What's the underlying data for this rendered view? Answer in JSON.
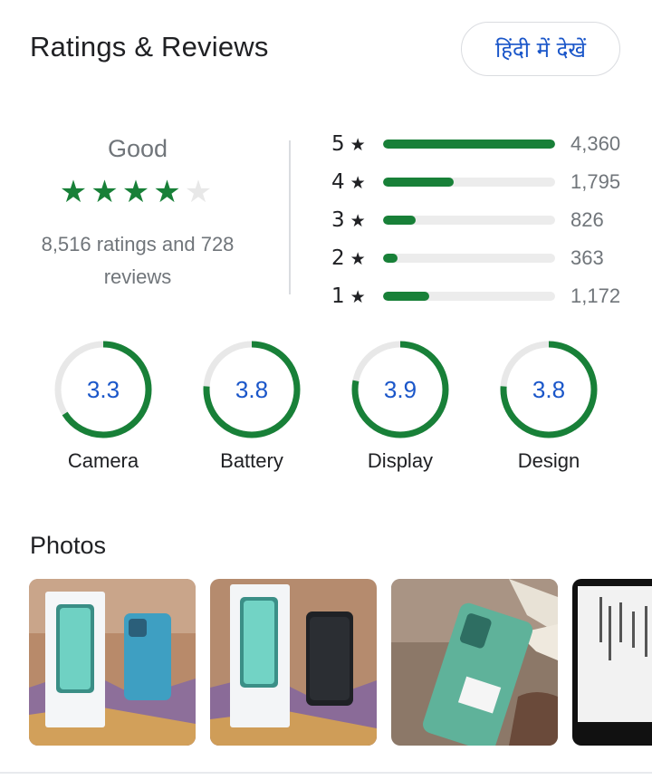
{
  "header": {
    "title": "Ratings & Reviews",
    "language_button": "हिंदी में देखें"
  },
  "summary": {
    "verdict": "Good",
    "stars_filled": 4,
    "stars_total": 5,
    "count_text": "8,516 ratings and 728 reviews"
  },
  "distribution": [
    {
      "label": "5",
      "count": "4,360",
      "value": 4360
    },
    {
      "label": "4",
      "count": "1,795",
      "value": 1795
    },
    {
      "label": "3",
      "count": "826",
      "value": 826
    },
    {
      "label": "2",
      "count": "363",
      "value": 363
    },
    {
      "label": "1",
      "count": "1,172",
      "value": 1172
    }
  ],
  "aspects": [
    {
      "name": "Camera",
      "score": "3.3",
      "fraction": 0.66
    },
    {
      "name": "Battery",
      "score": "3.8",
      "fraction": 0.76
    },
    {
      "name": "Display",
      "score": "3.9",
      "fraction": 0.78
    },
    {
      "name": "Design",
      "score": "3.8",
      "fraction": 0.76
    }
  ],
  "photos": {
    "title": "Photos",
    "items": [
      {
        "subject": "phone-box-and-blue-phone"
      },
      {
        "subject": "phone-box-and-dark-screen-phone"
      },
      {
        "subject": "green-phone-in-hand"
      },
      {
        "subject": "phone-screen-text"
      }
    ]
  },
  "colors": {
    "accent_green": "#188038",
    "score_blue": "#1a56c9",
    "track_gray": "#e8e8e8"
  }
}
